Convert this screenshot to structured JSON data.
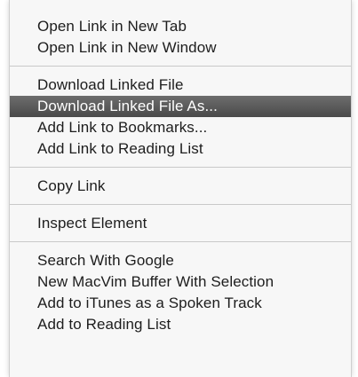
{
  "menu": {
    "groups": [
      {
        "items": [
          {
            "label": "Open Link in New Tab"
          },
          {
            "label": "Open Link in New Window"
          }
        ]
      },
      {
        "items": [
          {
            "label": "Download Linked File"
          },
          {
            "label": "Download Linked File As..."
          },
          {
            "label": "Add Link to Bookmarks..."
          },
          {
            "label": "Add Link to Reading List"
          }
        ]
      },
      {
        "items": [
          {
            "label": "Copy Link"
          }
        ]
      },
      {
        "items": [
          {
            "label": "Inspect Element"
          }
        ]
      },
      {
        "items": [
          {
            "label": "Search With Google"
          },
          {
            "label": "New MacVim Buffer With Selection"
          },
          {
            "label": "Add to iTunes as a Spoken Track"
          },
          {
            "label": "Add to Reading List"
          }
        ]
      }
    ]
  },
  "colors": {
    "menu_background": "#f7f7f7",
    "highlight_background": "#5b5b5b",
    "highlight_text": "#ffffff",
    "text": "#1d1d1d",
    "separator": "#c9c9c9"
  }
}
